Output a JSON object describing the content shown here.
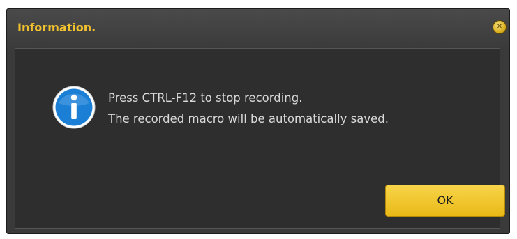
{
  "dialog": {
    "title": "Information.",
    "close_icon": "close-icon",
    "message_icon": "info-icon",
    "message_lines": [
      "Press CTRL-F12 to stop recording.",
      "The recorded macro will be automatically saved."
    ],
    "ok_label": "OK"
  },
  "colors": {
    "title_text": "#f2c12e",
    "dialog_bg": "#3a3a3a",
    "content_bg": "#2e2e2e",
    "button_bg": "#f1c630",
    "info_icon_bg": "#1b7fd6"
  }
}
